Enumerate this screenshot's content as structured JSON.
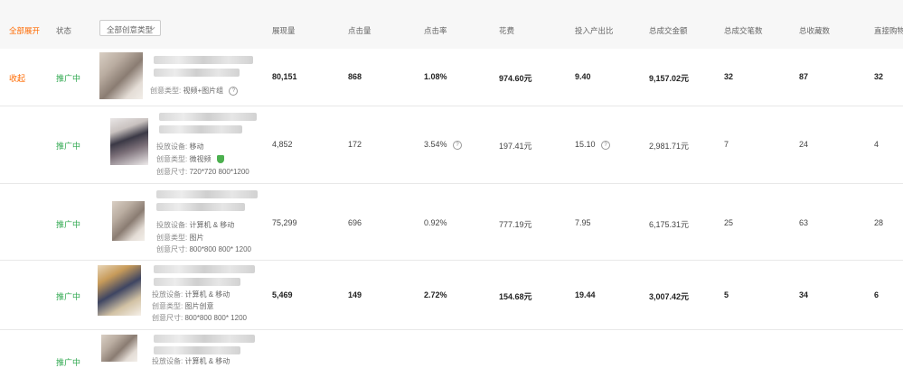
{
  "header": {
    "expand_all": "全部展开",
    "status": "状态",
    "creative_type_select": "全部创意类型",
    "impressions": "展现量",
    "clicks": "点击量",
    "ctr": "点击率",
    "spend": "花费",
    "roi": "投入产出比",
    "total_gmv": "总成交金额",
    "total_orders": "总成交笔数",
    "total_favorites": "总收藏数",
    "direct_cart": "直接购物"
  },
  "rows": [
    {
      "action": "收起",
      "status": "推广中",
      "meta": [
        {
          "label": "创意类型:",
          "value": "视频+图片组"
        }
      ],
      "impressions": "80,151",
      "clicks": "868",
      "ctr": "1.08%",
      "spend": "974.60元",
      "roi": "9.40",
      "gmv": "9,157.02元",
      "orders": "32",
      "favorites": "87",
      "cart": "32"
    },
    {
      "status": "推广中",
      "meta": [
        {
          "label": "投放设备:",
          "value": "移动"
        },
        {
          "label": "创意类型:",
          "value": "微视频"
        },
        {
          "label": "创意尺寸:",
          "value": "720*720 800*1200"
        }
      ],
      "impressions": "4,852",
      "clicks": "172",
      "ctr": "3.54%",
      "spend": "197.41元",
      "roi": "15.10",
      "gmv": "2,981.71元",
      "orders": "7",
      "favorites": "24",
      "cart": "4"
    },
    {
      "status": "推广中",
      "meta": [
        {
          "label": "投放设备:",
          "value": "计算机 & 移动"
        },
        {
          "label": "创意类型:",
          "value": "图片"
        },
        {
          "label": "创意尺寸:",
          "value": "800*800 800* 1200"
        }
      ],
      "impressions": "75,299",
      "clicks": "696",
      "ctr": "0.92%",
      "spend": "777.19元",
      "roi": "7.95",
      "gmv": "6,175.31元",
      "orders": "25",
      "favorites": "63",
      "cart": "28"
    },
    {
      "status": "推广中",
      "meta": [
        {
          "label": "投放设备:",
          "value": "计算机 & 移动"
        },
        {
          "label": "创意类型:",
          "value": "图片创意"
        },
        {
          "label": "创意尺寸:",
          "value": "800*800 800* 1200"
        }
      ],
      "impressions": "5,469",
      "clicks": "149",
      "ctr": "2.72%",
      "spend": "154.68元",
      "roi": "19.44",
      "gmv": "3,007.42元",
      "orders": "5",
      "favorites": "34",
      "cart": "6"
    },
    {
      "status": "推广中",
      "meta": [
        {
          "label": "投放设备:",
          "value": "计算机 & 移动"
        }
      ]
    }
  ]
}
